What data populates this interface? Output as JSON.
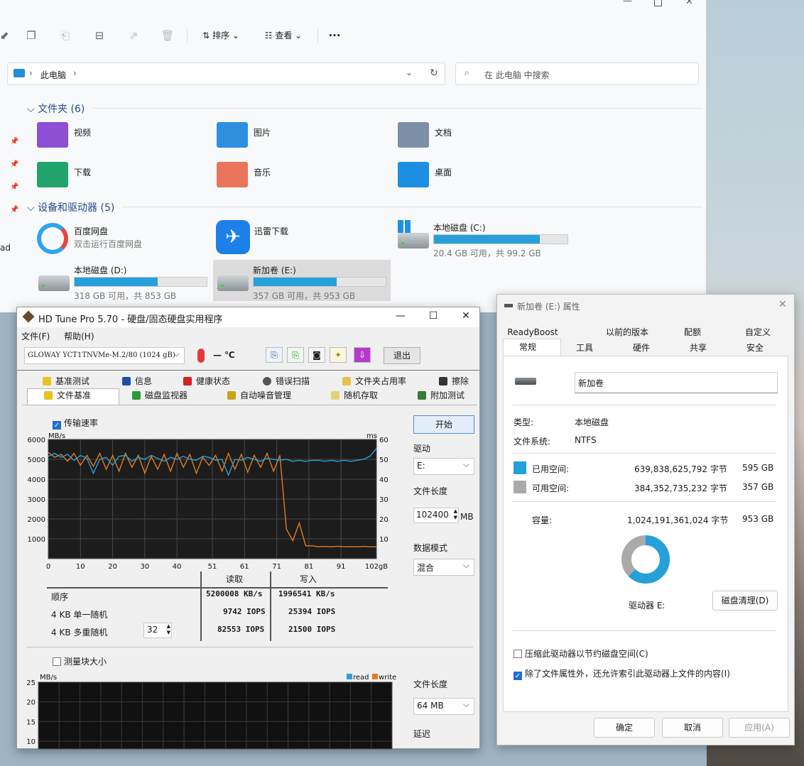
{
  "explorer": {
    "toolbar": {
      "sort": "排序",
      "view": "查看",
      "more": "···"
    },
    "address": {
      "path": "此电脑",
      "sep": "›"
    },
    "search": {
      "placeholder": "在 此电脑 中搜索"
    },
    "side_text": "ad",
    "folders_header": "文件夹 (6)",
    "folders": [
      {
        "name": "视频",
        "icon": "video-folder-icon",
        "color": "#8d4fd6"
      },
      {
        "name": "图片",
        "icon": "pictures-folder-icon",
        "color": "#2f8ee0"
      },
      {
        "name": "文档",
        "icon": "documents-folder-icon",
        "color": "#7b8fa6"
      },
      {
        "name": "下载",
        "icon": "downloads-folder-icon",
        "color": "#22a36b"
      },
      {
        "name": "音乐",
        "icon": "music-folder-icon",
        "color": "#e9745a"
      },
      {
        "name": "桌面",
        "icon": "desktop-folder-icon",
        "color": "#1c8fe3"
      }
    ],
    "drives_header": "设备和驱动器 (5)",
    "drives": [
      {
        "name": "百度网盘",
        "sub": "双击运行百度网盘",
        "icon": "baidu-netdisk-icon"
      },
      {
        "name": "迅雷下载",
        "sub": "",
        "icon": "xunlei-icon"
      },
      {
        "name": "本地磁盘 (C:)",
        "sub": "20.4 GB 可用，共 99.2 GB",
        "used": 0.79,
        "icon": "windows-drive-icon"
      },
      {
        "name": "本地磁盘 (D:)",
        "sub": "318 GB 可用，共 853 GB",
        "used": 0.63,
        "icon": "drive-icon"
      },
      {
        "name": "新加卷 (E:)",
        "sub": "357 GB 可用，共 953 GB",
        "used": 0.63,
        "icon": "drive-icon"
      }
    ]
  },
  "hdtune": {
    "title": "HD Tune Pro 5.70 - 硬盘/固态硬盘实用程序",
    "menu": [
      "文件(F)",
      "帮助(H)"
    ],
    "drive_select": "GLOWAY YCT1TNVMe-M.2/80 (1024 gB)",
    "temp": "— ℃",
    "exit": "退出",
    "tabs_row1": [
      "基准测试",
      "信息",
      "健康状态",
      "错误扫描",
      "文件夹占用率",
      "擦除"
    ],
    "tabs_row2": [
      "文件基准",
      "磁盘监视器",
      "自动噪音管理",
      "随机存取",
      "附加测试"
    ],
    "transfer_rate": "传输速率",
    "start": "开始",
    "drive_label": "驱动",
    "drive_value": "E:",
    "file_length_label": "文件长度",
    "file_length_value": "102400",
    "file_length_unit": "MB",
    "data_mode_label": "数据模式",
    "data_mode_value": "混合",
    "table": {
      "read": "读取",
      "write": "写入",
      "rows": [
        {
          "label": "顺序",
          "read": "5200008 KB/s",
          "write": "1996541 KB/s"
        },
        {
          "label": "4 KB 单一随机",
          "read": "9742 IOPS",
          "write": "25394 IOPS"
        },
        {
          "label": "4 KB 多重随机",
          "read": "82553 IOPS",
          "write": "21500 IOPS"
        }
      ],
      "queue": "32"
    },
    "block_size": "测量块大小",
    "file_length2_label": "文件长度",
    "file_length2_value": "64 MB",
    "delay_label": "延迟",
    "legend": {
      "read": "read",
      "write": "write"
    }
  },
  "chart_data": [
    {
      "type": "line",
      "ylabel": "MB/s",
      "y2label": "ms",
      "ylim": [
        0,
        6000
      ],
      "y2lim": [
        0,
        60
      ],
      "xlim": [
        0,
        102
      ],
      "xunit": "gB",
      "yticks": [
        1000,
        2000,
        3000,
        4000,
        5000,
        6000
      ],
      "y2ticks": [
        10,
        20,
        30,
        40,
        50,
        60
      ],
      "xticks": [
        "0",
        "10",
        "20",
        "30",
        "40",
        "51",
        "61",
        "71",
        "81",
        "91",
        "102gB"
      ],
      "series": [
        {
          "name": "read",
          "color": "#2a9fd6",
          "x": [
            0,
            2,
            4,
            6,
            8,
            10,
            12,
            14,
            16,
            18,
            20,
            22,
            24,
            26,
            28,
            30,
            32,
            34,
            36,
            38,
            40,
            42,
            44,
            46,
            48,
            50,
            52,
            54,
            56,
            58,
            60,
            62,
            64,
            66,
            68,
            70,
            72,
            74,
            76,
            78,
            80,
            82,
            84,
            86,
            88,
            90,
            92,
            94,
            96,
            98,
            100,
            102
          ],
          "y": [
            5150,
            5300,
            5100,
            5250,
            4950,
            5200,
            5050,
            4300,
            5000,
            5100,
            4700,
            5150,
            5200,
            4900,
            5100,
            5000,
            5200,
            5050,
            4900,
            5100,
            5000,
            5150,
            5000,
            4950,
            5150,
            5100,
            4950,
            5000,
            4200,
            5000,
            4950,
            5100,
            5000,
            4900,
            5050,
            5000,
            4950,
            5000,
            4900,
            4950,
            4900,
            4950,
            4950,
            4900,
            4950,
            4900,
            4950,
            4900,
            4950,
            5000,
            5150,
            5550
          ]
        },
        {
          "name": "write",
          "color": "#e07d20",
          "x": [
            0,
            2,
            4,
            6,
            8,
            10,
            12,
            14,
            16,
            18,
            20,
            22,
            24,
            26,
            28,
            30,
            32,
            34,
            36,
            38,
            40,
            42,
            44,
            46,
            48,
            50,
            52,
            54,
            56,
            58,
            60,
            62,
            64,
            66,
            68,
            70,
            72,
            74,
            76,
            78,
            80,
            82,
            84,
            86,
            88,
            90,
            92,
            94,
            96,
            98,
            100,
            102
          ],
          "y": [
            5350,
            5100,
            5250,
            4900,
            5300,
            4700,
            5200,
            4650,
            5300,
            4500,
            5200,
            4400,
            5300,
            4600,
            5200,
            4300,
            5150,
            4500,
            5250,
            4400,
            5300,
            4600,
            5250,
            4300,
            5100,
            4700,
            5200,
            4400,
            5300,
            4500,
            5250,
            4350,
            5200,
            4600,
            5300,
            4400,
            5200,
            1500,
            900,
            1800,
            650,
            650,
            600,
            620,
            600,
            630,
            600,
            610,
            600,
            620,
            600,
            600
          ]
        }
      ]
    },
    {
      "type": "line",
      "ylabel": "MB/s",
      "ylim": [
        0,
        25
      ],
      "yticks": [
        10,
        15,
        20,
        25
      ],
      "series": [
        {
          "name": "read",
          "values": []
        },
        {
          "name": "write",
          "values": []
        }
      ]
    }
  ],
  "props": {
    "title": "新加卷 (E:) 属性",
    "tabs_row1": [
      "ReadyBoost",
      "以前的版本",
      "配额",
      "自定义"
    ],
    "tabs_row2": [
      "常规",
      "工具",
      "硬件",
      "共享",
      "安全"
    ],
    "volume_name": "新加卷",
    "type_label": "类型:",
    "type_value": "本地磁盘",
    "fs_label": "文件系统:",
    "fs_value": "NTFS",
    "used_label": "已用空间:",
    "used_bytes": "639,838,625,792 字节",
    "used_gb": "595 GB",
    "used_color": "#26a0da",
    "free_label": "可用空间:",
    "free_bytes": "384,352,735,232 字节",
    "free_gb": "357 GB",
    "free_color": "#aaaaaa",
    "cap_label": "容量:",
    "cap_bytes": "1,024,191,361,024 字节",
    "cap_gb": "953 GB",
    "used_fraction": 0.625,
    "drive_label": "驱动器 E:",
    "cleanup": "磁盘清理(D)",
    "compress": "压缩此驱动器以节约磁盘空间(C)",
    "index": "除了文件属性外，还允许索引此驱动器上文件的内容(I)",
    "ok": "确定",
    "cancel": "取消",
    "apply": "应用(A)"
  }
}
